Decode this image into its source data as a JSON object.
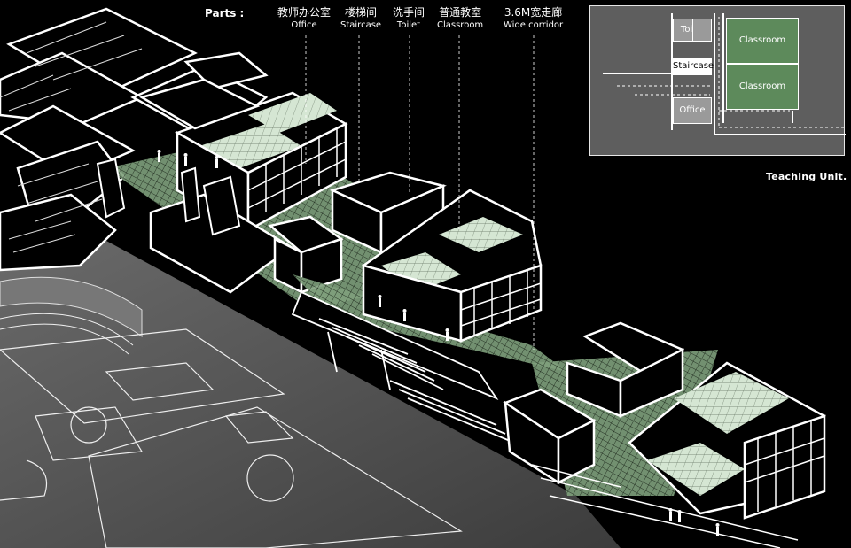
{
  "legend": {
    "title": "Parts :",
    "items": [
      {
        "zh": "教师办公室",
        "en": "Office"
      },
      {
        "zh": "楼梯间",
        "en": "Staircase"
      },
      {
        "zh": "洗手间",
        "en": "Toilet"
      },
      {
        "zh": "普通教室",
        "en": "Classroom"
      },
      {
        "zh": "3.6M宽走廊",
        "en": "Wide corridor"
      }
    ]
  },
  "unit_plan": {
    "labels": {
      "toilet": "Toilet",
      "staircase": "Staircase",
      "office": "Office",
      "classroom_top": "Classroom",
      "classroom_bottom": "Classroom"
    },
    "caption": "Teaching Unit."
  },
  "colors": {
    "background": "#000000",
    "line": "#ffffff",
    "classroom_green": "#5d8a5b",
    "floor_tile": "#d5e6d3",
    "service_grey": "#9a9a9a",
    "inset_bg": "#5e5e5e",
    "court": "#4a4a4a"
  }
}
